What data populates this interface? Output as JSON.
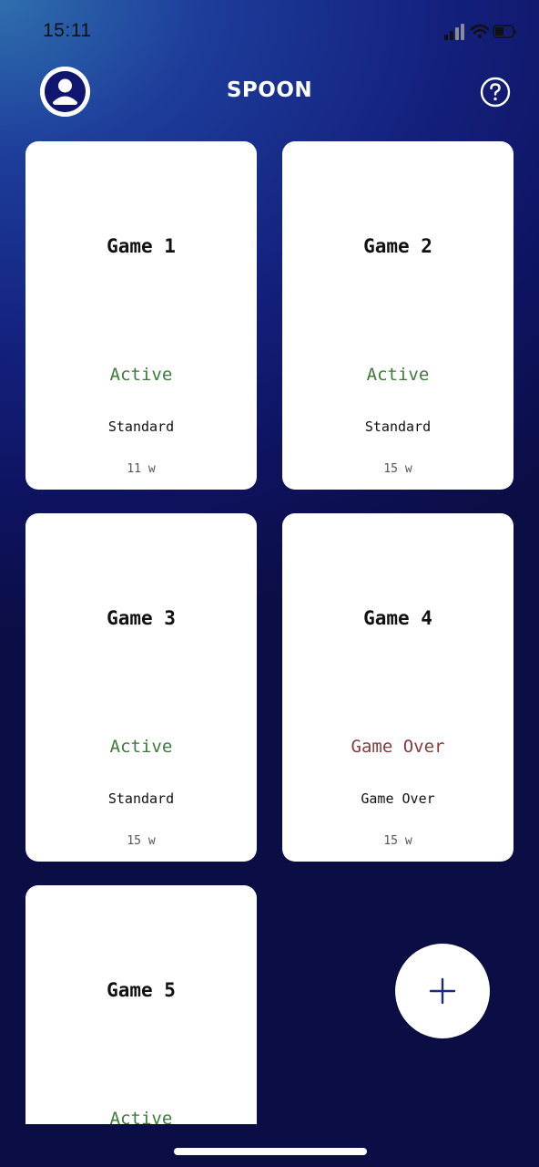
{
  "status_bar": {
    "time": "15:11"
  },
  "header": {
    "title": "SPOON",
    "profile_icon": "user-icon",
    "help_icon": "help-icon"
  },
  "colors": {
    "active": "#3f7a3a",
    "game_over": "#8a3a3a",
    "accent": "#1b2a7a"
  },
  "games": [
    {
      "title": "Game 1",
      "status": "Active",
      "mode": "Standard",
      "words": "11 w"
    },
    {
      "title": "Game 2",
      "status": "Active",
      "mode": "Standard",
      "words": "15 w"
    },
    {
      "title": "Game 3",
      "status": "Active",
      "mode": "Standard",
      "words": "15 w"
    },
    {
      "title": "Game 4",
      "status": "Game Over",
      "mode": "Game Over",
      "words": "15 w"
    },
    {
      "title": "Game 5",
      "status": "Active",
      "mode": "",
      "words": ""
    }
  ],
  "fab": {
    "icon": "plus-icon"
  }
}
